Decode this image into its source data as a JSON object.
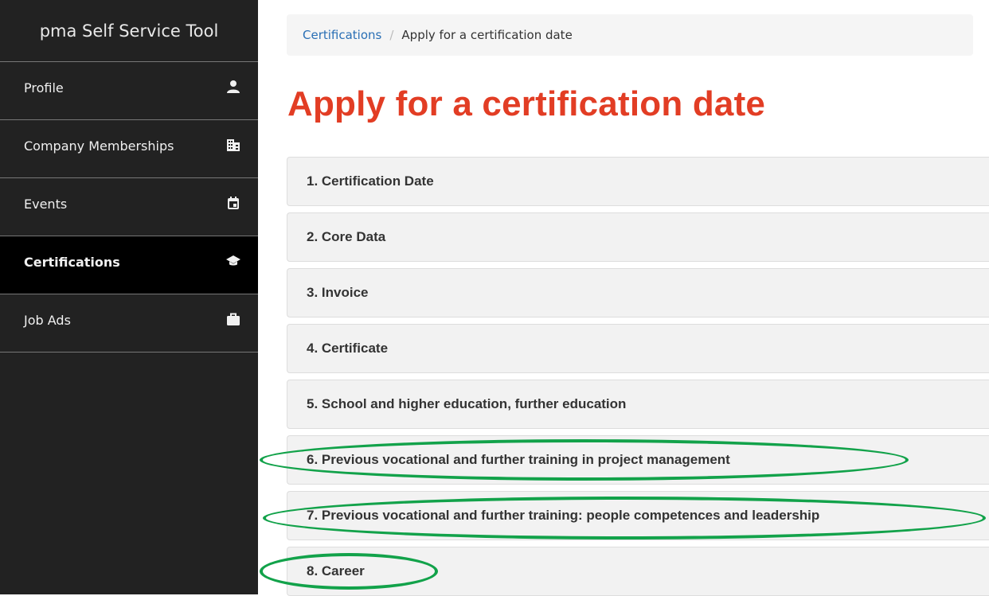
{
  "sidebar": {
    "title": "pma Self Service Tool",
    "items": [
      {
        "label": "Profile",
        "icon": "person-icon"
      },
      {
        "label": "Company Memberships",
        "icon": "building-icon"
      },
      {
        "label": "Events",
        "icon": "calendar-icon"
      },
      {
        "label": "Certifications",
        "icon": "graduation-cap-icon",
        "active": true
      },
      {
        "label": "Job Ads",
        "icon": "briefcase-icon"
      }
    ]
  },
  "breadcrumb": {
    "link": "Certifications",
    "separator": "/",
    "current": "Apply for a certification date"
  },
  "page_title": "Apply for a certification date",
  "panels": [
    "1. Certification Date",
    "2. Core Data",
    "3. Invoice",
    "4. Certificate",
    "5. School and higher education, further education",
    "6. Previous vocational and further training in project management",
    "7. Previous vocational and further training: people competences and leadership",
    "8. Career"
  ],
  "colors": {
    "sidebar_bg": "#222222",
    "active_bg": "#000000",
    "title_red": "#e23d24",
    "link_blue": "#2a6fb5",
    "highlight_green": "#12a24a"
  }
}
